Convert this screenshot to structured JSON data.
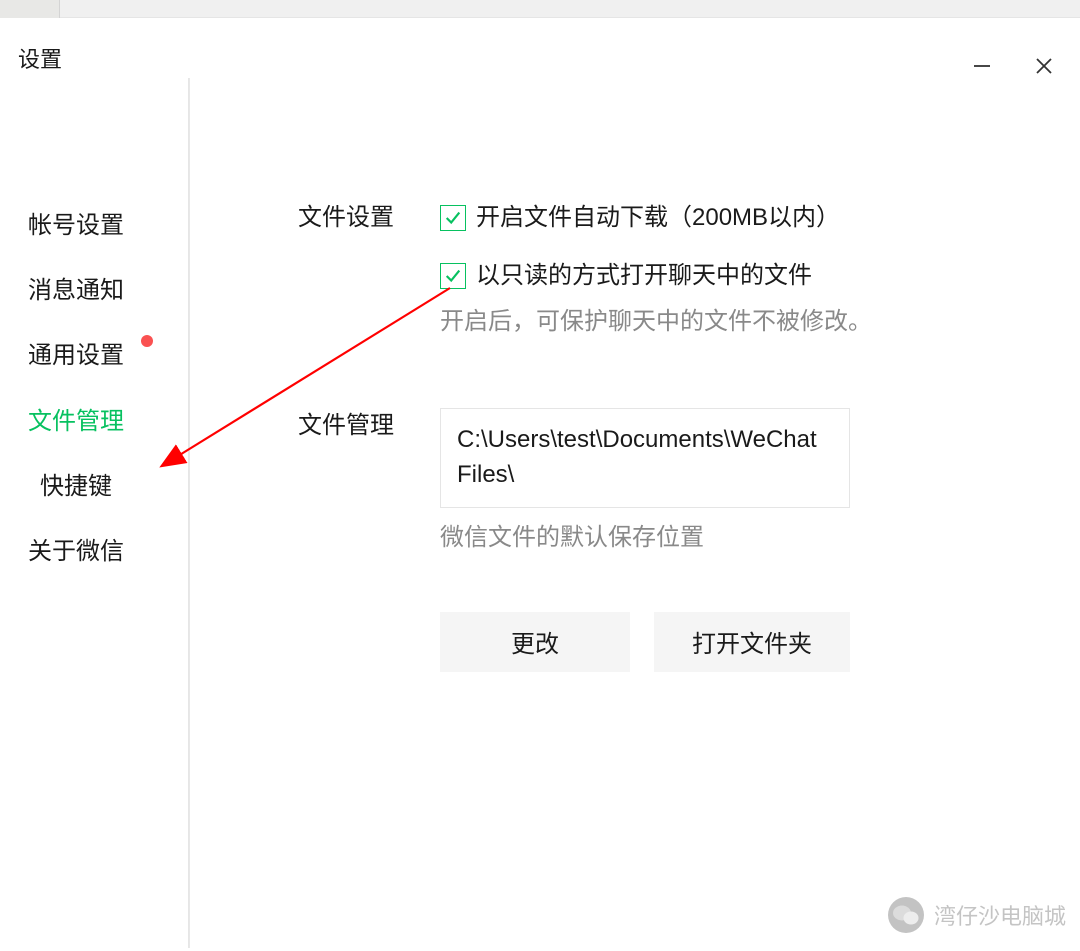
{
  "window": {
    "title": "设置"
  },
  "sidebar": {
    "items": [
      {
        "label": "帐号设置",
        "active": false
      },
      {
        "label": "消息通知",
        "active": false
      },
      {
        "label": "通用设置",
        "active": false,
        "has_red_dot": true
      },
      {
        "label": "文件管理",
        "active": true
      },
      {
        "label": "快捷键",
        "active": false,
        "indent": true
      },
      {
        "label": "关于微信",
        "active": false
      }
    ]
  },
  "settings": {
    "file_settings_label": "文件设置",
    "auto_download": {
      "checked": true,
      "label": "开启文件自动下载（200MB以内）"
    },
    "readonly_open": {
      "checked": true,
      "label": "以只读的方式打开聊天中的文件",
      "hint": "开启后，可保护聊天中的文件不被修改。"
    },
    "file_management_label": "文件管理",
    "path_value": "C:\\Users\\test\\Documents\\WeChat Files\\",
    "path_hint": "微信文件的默认保存位置",
    "change_button": "更改",
    "open_folder_button": "打开文件夹"
  },
  "watermark": {
    "text": "湾仔沙电脑城"
  },
  "colors": {
    "accent": "#07c160",
    "red_dot": "#fa5151",
    "hint": "#898989"
  }
}
